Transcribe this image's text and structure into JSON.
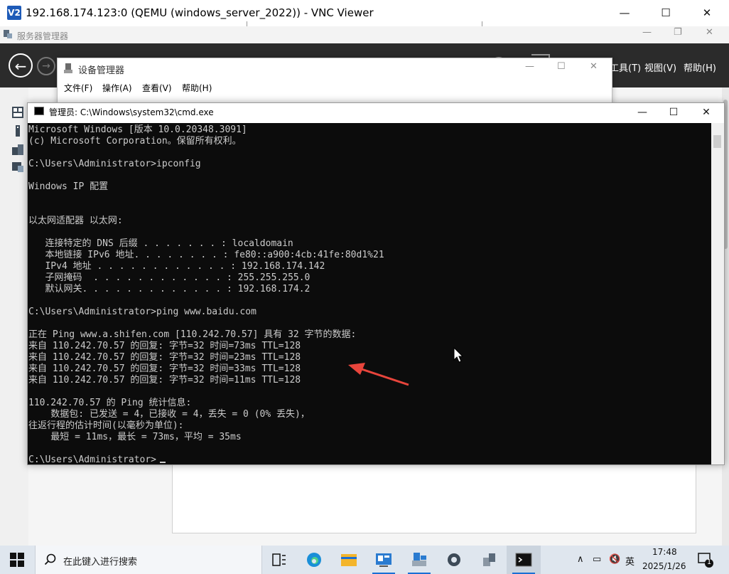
{
  "vnc": {
    "title": "192.168.174.123:0 (QEMU (windows_server_2022)) - VNC Viewer",
    "logo": "V2",
    "minimize": "—",
    "maximize": "☐",
    "close": "✕"
  },
  "server_manager": {
    "title": "服务器管理器",
    "menu": [
      "工具(T)",
      "视图(V)",
      "帮助(H)"
    ]
  },
  "device_manager": {
    "title": "设备管理器",
    "menu": [
      "文件(F)",
      "操作(A)",
      "查看(V)",
      "帮助(H)"
    ]
  },
  "cmd": {
    "title": "管理员: C:\\Windows\\system32\\cmd.exe",
    "lines": [
      "Microsoft Windows [版本 10.0.20348.3091]",
      "(c) Microsoft Corporation。保留所有权利。",
      "",
      "C:\\Users\\Administrator>ipconfig",
      "",
      "Windows IP 配置",
      "",
      "",
      "以太网适配器 以太网:",
      "",
      "   连接特定的 DNS 后缀 . . . . . . . : localdomain",
      "   本地链接 IPv6 地址. . . . . . . . : fe80::a900:4cb:41fe:80d1%21",
      "   IPv4 地址 . . . . . . . . . . . . : 192.168.174.142",
      "   子网掩码  . . . . . . . . . . . . : 255.255.255.0",
      "   默认网关. . . . . . . . . . . . . : 192.168.174.2",
      "",
      "C:\\Users\\Administrator>ping www.baidu.com",
      "",
      "正在 Ping www.a.shifen.com [110.242.70.57] 具有 32 字节的数据:",
      "来自 110.242.70.57 的回复: 字节=32 时间=73ms TTL=128",
      "来自 110.242.70.57 的回复: 字节=32 时间=23ms TTL=128",
      "来自 110.242.70.57 的回复: 字节=32 时间=33ms TTL=128",
      "来自 110.242.70.57 的回复: 字节=32 时间=11ms TTL=128",
      "",
      "110.242.70.57 的 Ping 统计信息:",
      "    数据包: 已发送 = 4，已接收 = 4，丢失 = 0 (0% 丢失)，",
      "往返行程的估计时间(以毫秒为单位):",
      "    最短 = 11ms，最长 = 73ms，平均 = 35ms",
      "",
      "C:\\Users\\Administrator>"
    ]
  },
  "taskbar": {
    "search_placeholder": "在此键入进行搜索",
    "ime": "英",
    "time": "17:48",
    "date": "2025/1/26",
    "notification_count": "1"
  },
  "colors": {
    "console_bg": "#0c0c0c",
    "console_text": "#cccccc",
    "annotation_arrow": "#e8453c",
    "accent": "#1a6fd4"
  }
}
